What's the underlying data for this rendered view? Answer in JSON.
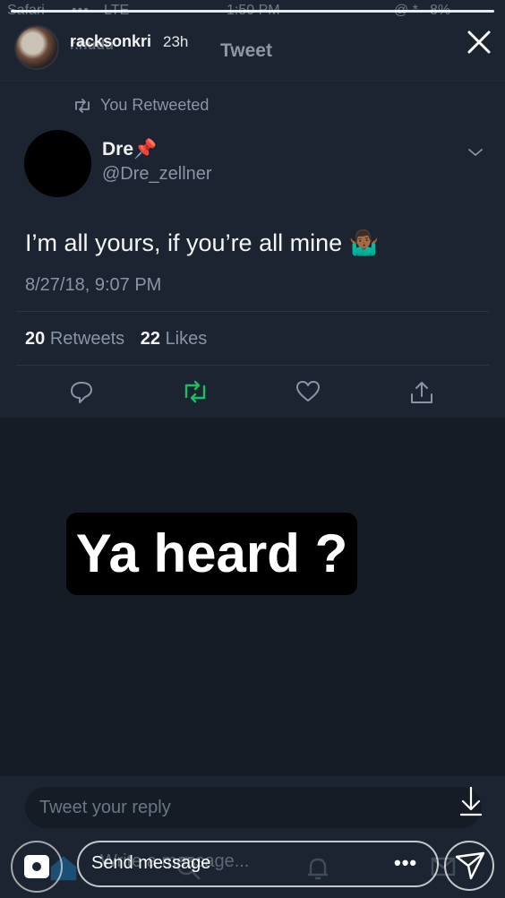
{
  "status_bar": {
    "carrier": "Safari",
    "signal": "•••",
    "network": "LTE",
    "time": "1:50 PM",
    "icons": "@ *",
    "battery": "8%"
  },
  "story": {
    "progress": 1.0,
    "username": "racksonkri",
    "username_ghost": "r.hudu",
    "time_ago": "23h",
    "title": "Tweet",
    "close_icon": "close-icon"
  },
  "tweet": {
    "retweet_note": "You Retweeted",
    "author_name": "Dre",
    "author_emoji": "📌",
    "author_handle": "@Dre_zellner",
    "text": "I’m all yours, if you’re all mine",
    "text_emoji": "🤷🏾‍♂️",
    "date": "8/27/18, 9:07 PM",
    "retweets_count": "20",
    "retweets_label": "Retweets",
    "likes_count": "22",
    "likes_label": "Likes",
    "accent_color": "#17bf63"
  },
  "overlay": {
    "text": "Ya heard ?"
  },
  "reply": {
    "placeholder": "Tweet your reply"
  },
  "story_footer": {
    "message_placeholder_ghost": "Write a message...",
    "send_message_label": "Send message",
    "more_label": "•••"
  }
}
